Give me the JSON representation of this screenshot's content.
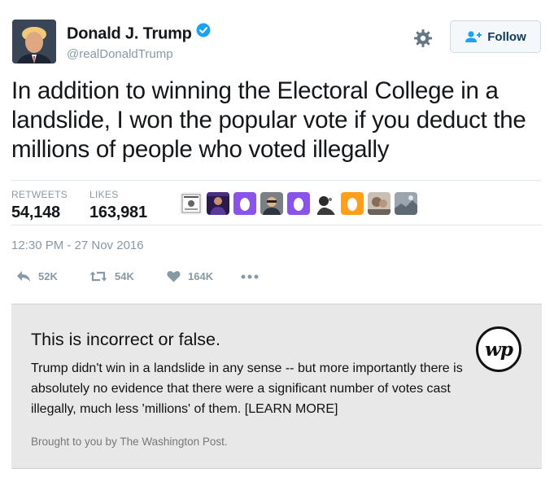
{
  "user": {
    "display_name": "Donald J. Trump",
    "handle": "@realDonaldTrump",
    "verified": true
  },
  "follow_button": {
    "label": "Follow"
  },
  "tweet": {
    "text": "In addition to winning the Electoral College in a landslide, I won the popular vote if you deduct the millions of people who voted illegally",
    "timestamp": "12:30 PM - 27 Nov 2016"
  },
  "stats": {
    "retweets_label": "RETWEETS",
    "retweets_value": "54,148",
    "likes_label": "LIKES",
    "likes_value": "163,981"
  },
  "liker_avatars": [
    "photo",
    "photo",
    "egg-purple",
    "photo",
    "egg-purple",
    "photo",
    "egg-orange",
    "photo",
    "photo"
  ],
  "actions": {
    "reply_count": "52K",
    "retweet_count": "54K",
    "like_count": "164K"
  },
  "fact_check": {
    "title": "This is incorrect or false.",
    "body": "Trump didn't win in a landslide in any sense -- but more importantly there is absolutely no evidence that there were a significant number of votes cast illegally, much less 'millions' of them. [LEARN MORE]",
    "source": "Brought to you by The Washington Post.",
    "logo_text": "wp"
  },
  "colors": {
    "verified_blue": "#1da1f2",
    "egg_purple": "#8b54e8",
    "egg_orange": "#ff9f1c",
    "muted_gray": "#8899a6",
    "factbox_bg": "#e8e8e8"
  }
}
